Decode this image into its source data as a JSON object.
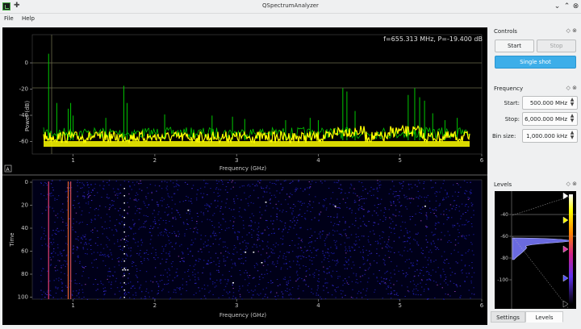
{
  "window": {
    "title": "QSpectrumAnalyzer",
    "min": "⌄",
    "max": "⌃",
    "close": "⊗",
    "pin": "✚"
  },
  "menu": {
    "file": "File",
    "help": "Help"
  },
  "spectrum": {
    "readout": "f=655.313 MHz, P=-19.400 dB",
    "ylabel": "Power (dB)",
    "xlabel": "Frequency (GHz)",
    "yticks": [
      "0",
      "-20",
      "-40",
      "-60"
    ],
    "xticks": [
      "1",
      "2",
      "3",
      "4",
      "5",
      "6"
    ],
    "autoscale": "A"
  },
  "waterfall": {
    "ylabel": "Time",
    "xlabel": "Frequency (GHz)",
    "yticks": [
      "0",
      "20",
      "40",
      "60",
      "80",
      "100"
    ],
    "xticks": [
      "1",
      "2",
      "3",
      "4",
      "5",
      "6"
    ]
  },
  "controls": {
    "title": "Controls",
    "start": "Start",
    "stop": "Stop",
    "single_shot": "Single shot"
  },
  "frequency": {
    "title": "Frequency",
    "start_label": "Start:",
    "start_value": "500.000 MHz",
    "stop_label": "Stop:",
    "stop_value": "6,000.000 MHz",
    "bin_label": "Bin size:",
    "bin_value": "1,000.000 kHz"
  },
  "levels": {
    "title": "Levels",
    "ticks": [
      "-40",
      "-60",
      "-80",
      "-100"
    ]
  },
  "tabs": {
    "settings": "Settings",
    "levels": "Levels"
  },
  "dock_controls": "◇ ⊗",
  "colors": {
    "accent": "#3daee9",
    "trace": "#ffff00",
    "peak": "#00c800",
    "grid": "#6b6b4a"
  }
}
